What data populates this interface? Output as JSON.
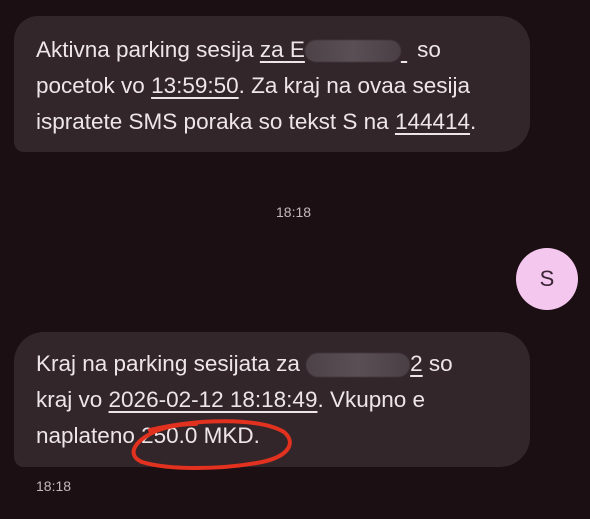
{
  "message1": {
    "line1_a": "Aktivna parking sesija ",
    "line1_b": "za E",
    "line1_c": " so",
    "line2_a": "pocetok vo ",
    "line2_time": "13:59:50",
    "line2_b": ". Za kraj na ovaa sesija",
    "line3_a": "ispratete SMS poraka so tekst S na ",
    "line3_number": "144414",
    "line3_b": "."
  },
  "timestamp_center": "18:18",
  "sent_message": {
    "avatar_letter": "S"
  },
  "message2": {
    "line1_a": "Kraj na parking sesijata za ",
    "line1_b": "2",
    "line1_c": " so",
    "line2_a": "kraj vo ",
    "line2_datetime": "2026-02-12 18:18:49",
    "line2_b": ". Vkupno e",
    "line3_a": "naplateno ",
    "line3_amount": "250.0 MKD",
    "line3_b": "."
  },
  "timestamp_bottom": "18:18",
  "colors": {
    "background": "#1c0f14",
    "bubble": "#33262b",
    "avatar": "#f4c8ee",
    "highlight_circle": "#e2321f"
  }
}
